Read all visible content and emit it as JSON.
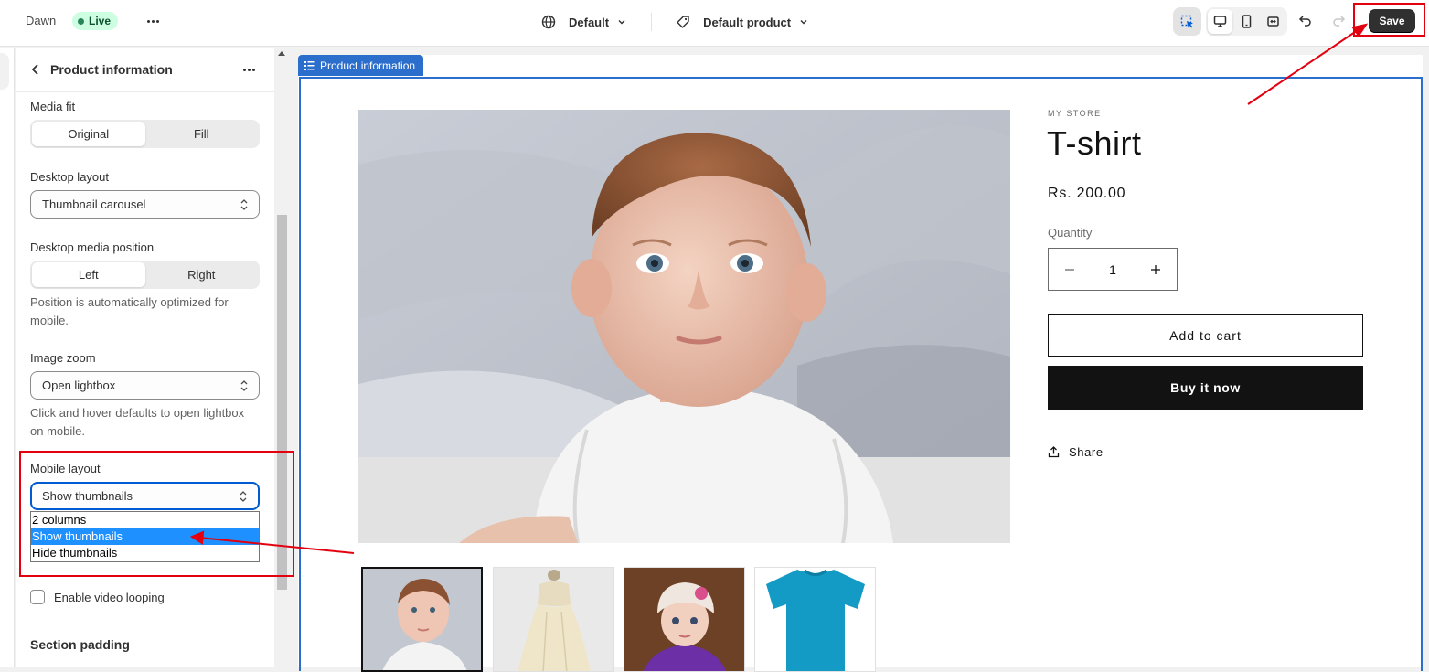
{
  "topbar": {
    "theme_name": "Dawn",
    "live_label": "Live",
    "locale_selector": "Default",
    "template_selector": "Default product",
    "save_label": "Save"
  },
  "panel": {
    "title": "Product information",
    "media_fit": {
      "label": "Media fit",
      "options": [
        "Original",
        "Fill"
      ],
      "selected": "Original"
    },
    "desktop_layout": {
      "label": "Desktop layout",
      "value": "Thumbnail carousel"
    },
    "desktop_media_position": {
      "label": "Desktop media position",
      "options": [
        "Left",
        "Right"
      ],
      "selected": "Left",
      "help": "Position is automatically optimized for mobile."
    },
    "image_zoom": {
      "label": "Image zoom",
      "value": "Open lightbox",
      "help": "Click and hover defaults to open lightbox on mobile."
    },
    "mobile_layout": {
      "label": "Mobile layout",
      "value": "Show thumbnails",
      "options": [
        "2 columns",
        "Show thumbnails",
        "Hide thumbnails"
      ],
      "highlighted": "Show thumbnails"
    },
    "video_looping_label": "Enable video looping",
    "section_padding_heading": "Section padding"
  },
  "preview": {
    "section_tag": "Product information",
    "vendor": "MY STORE",
    "product_title": "T-shirt",
    "price": "Rs. 200.00",
    "quantity_label": "Quantity",
    "quantity_value": "1",
    "add_to_cart": "Add to cart",
    "buy_now": "Buy it now",
    "share": "Share"
  },
  "colors": {
    "accent": "#2c6ecb",
    "annotation_red": "#e3000f",
    "live_badge_bg": "#cdfee1",
    "save_bg": "#303030",
    "buy_now_bg": "#121212"
  }
}
